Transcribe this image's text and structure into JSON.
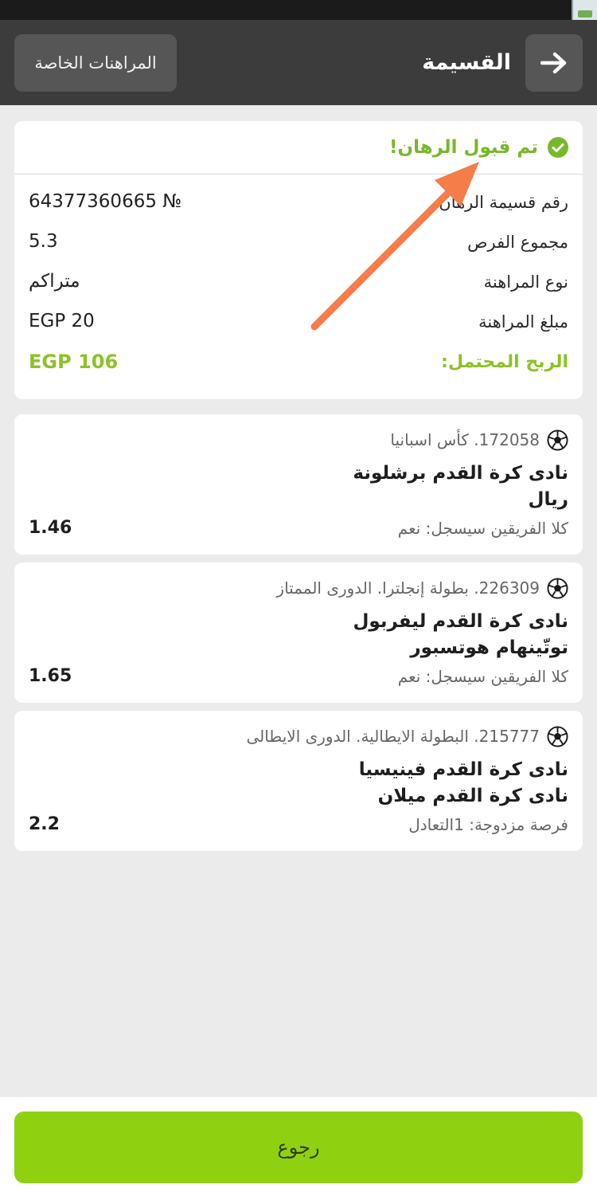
{
  "header": {
    "title": "القسيمة",
    "special_bets_label": "المراهنات الخاصة",
    "back_icon": "arrow-right-icon"
  },
  "summary": {
    "accepted_text": "تم قبول الرهان!",
    "rows": [
      {
        "label": "رقم قسيمة الرهان",
        "value": "64377360665 №"
      },
      {
        "label": "مجموع الفرص",
        "value": "5.3"
      },
      {
        "label": "نوع المراهنة",
        "value": "متراكم"
      },
      {
        "label": "مبلغ المراهنة",
        "value": "EGP 20"
      },
      {
        "label": "الربح المحتمل:",
        "value": "EGP 106"
      }
    ]
  },
  "events": [
    {
      "league": "172058. كأس اسبانيا",
      "team1": "نادى كرة القدم برشلونة",
      "team2": "ريال",
      "market": "كلا الفريقين سيسجل: نعم",
      "odd": "1.46"
    },
    {
      "league": "226309. بطولة إنجلترا. الدورى الممتاز",
      "team1": "نادى كرة القدم ليفربول",
      "team2": "توتّينهام هوتسبور",
      "market": "كلا الفريقين سيسجل: نعم",
      "odd": "1.65"
    },
    {
      "league": "215777. البطولة الايطالية. الدورى الايطالى",
      "team1": "نادى كرة القدم فينيسيا",
      "team2": "نادى كرة القدم ميلان",
      "market": "فرصة مزدوجة: 1التعادل",
      "odd": "2.2"
    }
  ],
  "footer": {
    "return_label": "رجوع"
  },
  "colors": {
    "accent_green": "#8dc227",
    "header_bg": "#3c3c3c",
    "annotation_arrow": "#f47d4a"
  }
}
